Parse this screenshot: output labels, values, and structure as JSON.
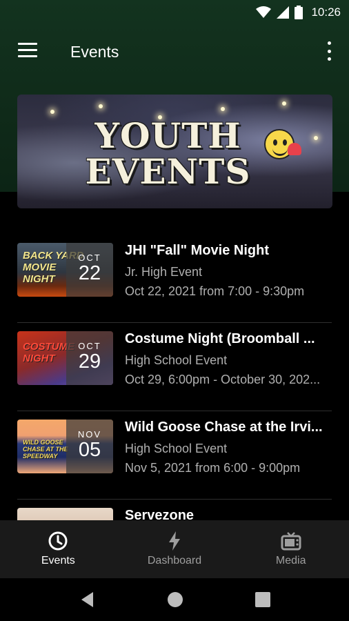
{
  "status_bar": {
    "time": "10:26"
  },
  "app_bar": {
    "title": "Events"
  },
  "banner": {
    "line1": "YOUTH",
    "line2": "EVENTS"
  },
  "events": [
    {
      "title": "JHI \"Fall\" Movie Night",
      "type": "Jr. High Event",
      "date": "Oct 22, 2021 from 7:00 - 9:30pm",
      "month": "OCT",
      "day": "22",
      "thumb_text": "BACK YARD MOVIE NIGHT"
    },
    {
      "title": "Costume Night (Broomball ...",
      "type": "High School Event",
      "date": "Oct 29, 6:00pm - October 30, 202...",
      "month": "OCT",
      "day": "29",
      "thumb_text": "COSTUME NIGHT"
    },
    {
      "title": "Wild Goose Chase at the Irvi...",
      "type": "High School Event",
      "date": "Nov 5, 2021 from 6:00 - 9:00pm",
      "month": "NOV",
      "day": "05",
      "thumb_text": "WILD GOOSE CHASE AT THE SPEEDWAY"
    },
    {
      "title": "Servezone",
      "type": "",
      "date": "",
      "month": "",
      "day": "",
      "thumb_text": ""
    }
  ],
  "bottom_nav": [
    {
      "label": "Events",
      "icon": "clock-icon",
      "active": true
    },
    {
      "label": "Dashboard",
      "icon": "lightning-icon",
      "active": false
    },
    {
      "label": "Media",
      "icon": "tv-icon",
      "active": false
    }
  ],
  "colors": {
    "header_bg": "#13331f",
    "nav_bg": "#1a1a1a",
    "secondary_text": "#b0b0b0"
  }
}
